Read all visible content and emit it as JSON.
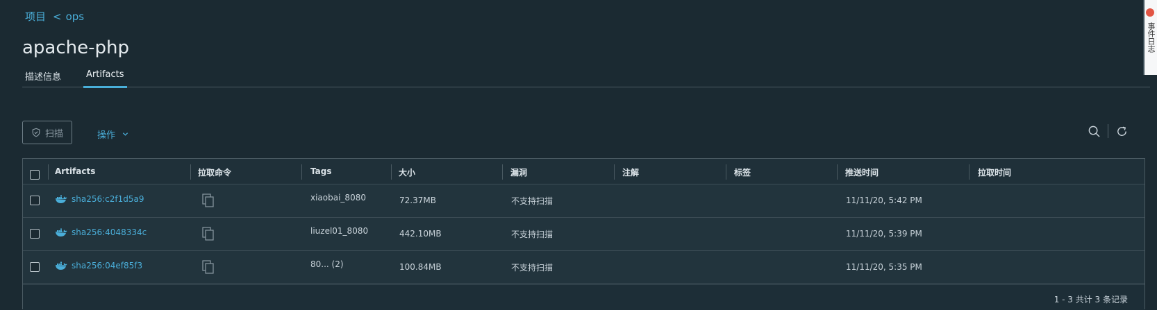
{
  "breadcrumb": {
    "projects_label": "项目",
    "separator": "<",
    "current": "ops"
  },
  "page_title": "apache-php",
  "tabs": [
    {
      "label": "描述信息",
      "active": false
    },
    {
      "label": "Artifacts",
      "active": true
    }
  ],
  "toolbar": {
    "scan_label": "扫描",
    "actions_label": "操作"
  },
  "side_tab": {
    "label": "事件日志"
  },
  "table": {
    "columns": [
      "Artifacts",
      "拉取命令",
      "Tags",
      "大小",
      "漏洞",
      "注解",
      "标签",
      "推送时间",
      "拉取时间"
    ],
    "rows": [
      {
        "artifact": "sha256:c2f1d5a9",
        "tags": "xiaobai_8080",
        "size": "72.37MB",
        "vulnerability": "不支持扫描",
        "annotation": "",
        "label": "",
        "push_time": "11/11/20, 5:42 PM",
        "pull_time": ""
      },
      {
        "artifact": "sha256:4048334c",
        "tags": "liuzel01_8080",
        "size": "442.10MB",
        "vulnerability": "不支持扫描",
        "annotation": "",
        "label": "",
        "push_time": "11/11/20, 5:39 PM",
        "pull_time": ""
      },
      {
        "artifact": "sha256:04ef85f3",
        "tags": "80... (2)",
        "size": "100.84MB",
        "vulnerability": "不支持扫描",
        "annotation": "",
        "label": "",
        "push_time": "11/11/20, 5:35 PM",
        "pull_time": ""
      }
    ],
    "footer": "1 - 3 共计 3 条记录"
  },
  "colors": {
    "background": "#1b2a32",
    "accent": "#4aaed9",
    "border": "#4b5b63",
    "text": "#c9d3da"
  },
  "icons": [
    "shield-icon",
    "chevron-down-icon",
    "search-icon",
    "refresh-icon",
    "docker-icon",
    "copy-icon"
  ]
}
